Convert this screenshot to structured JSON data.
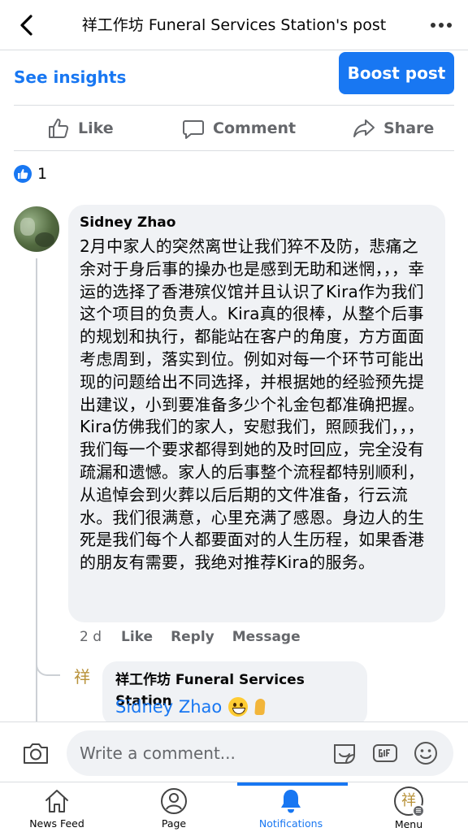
{
  "header": {
    "title": "祥工作坊 Funeral Services Station's post"
  },
  "insights": {
    "see_insights": "See insights",
    "boost_post": "Boost post"
  },
  "actions": {
    "like": "Like",
    "comment": "Comment",
    "share": "Share"
  },
  "reactions": {
    "count": "1"
  },
  "comment": {
    "author": "Sidney Zhao",
    "text": "2月中家人的突然离世让我们猝不及防，悲痛之余对于身后事的操办也是感到无助和迷惘，，，幸运的选择了香港殡仪馆并且认识了Kira作为我们这个项目的负责人。Kira真的很棒，从整个后事的规划和执行，都能站在客户的角度，方方面面考虑周到，落实到位。例如对每一个环节可能出现的问题给出不同选择，并根据她的经验预先提出建议，小到要准备多少个礼金包都准确把握。Kira仿佛我们的家人，安慰我们，照顾我们，，，我们每一个要求都得到她的及时回应，完全没有疏漏和遗憾。家人的后事整个流程都特别顺利，从追悼会到火葬以后后期的文件准备，行云流水。我们很满意，心里充满了感恩。身边人的生死是我们每个人都要面对的人生历程，如果香港的朋友有需要，我绝对推荐Kira的服务。",
    "time": "2 d",
    "like": "Like",
    "reply": "Reply",
    "message": "Message"
  },
  "reply": {
    "author": "祥工作坊 Funeral Services Station",
    "logo_char": "祥",
    "mention": "Sidney Zhao"
  },
  "composer": {
    "placeholder": "Write a comment..."
  },
  "nav": {
    "news_feed": "News Feed",
    "page": "Page",
    "notifications": "Notifications",
    "menu": "Menu",
    "menu_logo_char": "祥"
  },
  "colors": {
    "accent": "#1877f2",
    "muted": "#65676b",
    "bubble": "#f0f2f5"
  }
}
